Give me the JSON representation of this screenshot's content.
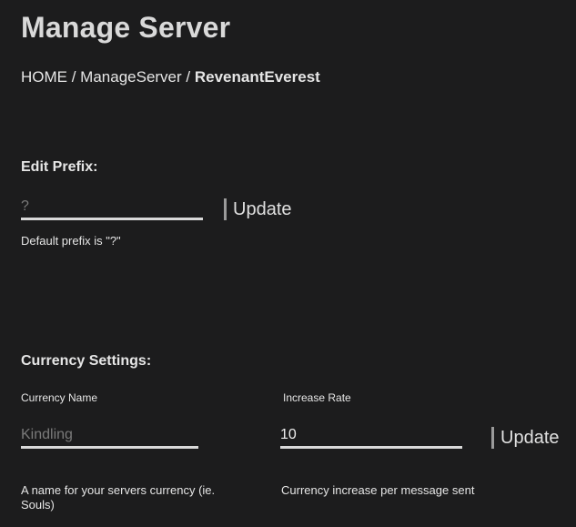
{
  "page": {
    "title": "Manage Server"
  },
  "breadcrumb": {
    "home": "HOME",
    "sep1": " / ",
    "manage": "ManageServer",
    "sep2": " / ",
    "current": "RevenantEverest"
  },
  "prefix": {
    "section_title": "Edit Prefix:",
    "input_placeholder": "?",
    "input_value": "",
    "update_label": "Update",
    "help": "Default prefix is \"?\""
  },
  "currency": {
    "section_title": "Currency Settings:",
    "name_label": "Currency Name",
    "name_placeholder": "Kindling",
    "name_value": "",
    "rate_label": "Increase Rate",
    "rate_value": "10",
    "update_label": "Update",
    "name_help": "A name for your servers currency (ie. Souls)",
    "rate_help": "Currency increase per message sent"
  }
}
